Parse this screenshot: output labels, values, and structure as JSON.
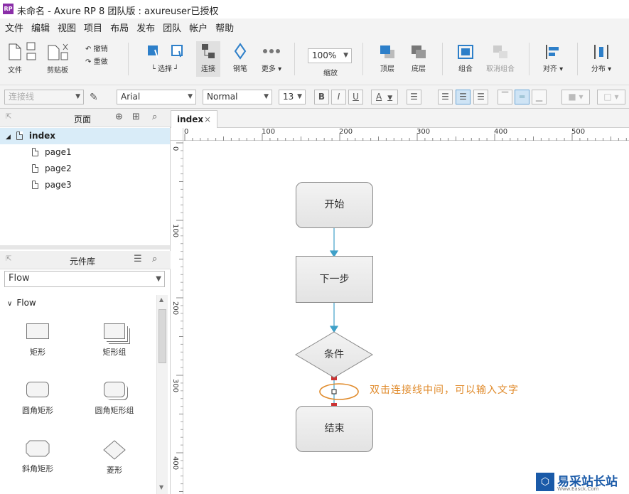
{
  "window": {
    "app_icon": "RP",
    "title": "未命名 - Axure RP 8 团队版 : axureuser已授权"
  },
  "menu": [
    "文件",
    "编辑",
    "视图",
    "项目",
    "布局",
    "发布",
    "团队",
    "帐户",
    "帮助"
  ],
  "toolbar": {
    "file_label": "文件",
    "clipboard_label": "剪贴板",
    "undo_label": "撤销",
    "redo_label": "重做",
    "select_label": "选择",
    "connect_label": "连接",
    "pen_label": "钢笔",
    "more_label": "更多 ▾",
    "zoom_value": "100%",
    "zoom_label": "缩放",
    "top_label": "顶层",
    "bottom_label": "底层",
    "group_label": "组合",
    "ungroup_label": "取消组合",
    "align_label": "对齐 ▾",
    "distribute_label": "分布 ▾"
  },
  "format": {
    "connector_type": "连接线",
    "font": "Arial",
    "style": "Normal",
    "size": "13",
    "bold": "B",
    "italic": "I",
    "underline": "U",
    "text_color": "A"
  },
  "pages_panel": {
    "title": "页面",
    "root": "index",
    "pages": [
      "page1",
      "page2",
      "page3"
    ]
  },
  "library_panel": {
    "title": "元件库",
    "selected_library": "Flow",
    "group_label": "Flow",
    "widgets": [
      "矩形",
      "矩形组",
      "圆角矩形",
      "圆角矩形组",
      "斜角矩形",
      "菱形"
    ]
  },
  "canvas": {
    "tab_label": "index",
    "tab_close": "×",
    "ruler_h_labels": [
      "0",
      "100",
      "200",
      "300",
      "400",
      "500"
    ],
    "ruler_v_labels": [
      "0",
      "100",
      "200",
      "300",
      "400"
    ],
    "nodes": {
      "start": "开始",
      "next": "下一步",
      "condition": "条件",
      "end": "结束"
    },
    "annotation": "双击连接线中间，可以输入文字",
    "connector_color": "#3fa0c8",
    "annotation_color": "#e08a2a"
  },
  "watermark": {
    "text": "易采站长站",
    "subtext": "Www.Easck.Com"
  },
  "icons": [
    "doc-icon",
    "undo-icon",
    "redo-icon",
    "select-icon",
    "connect-icon",
    "pen-icon",
    "more-icon",
    "top-icon",
    "bottom-icon",
    "group-icon",
    "ungroup-icon",
    "align-icon",
    "distribute-icon",
    "search-icon",
    "menu-icon"
  ]
}
